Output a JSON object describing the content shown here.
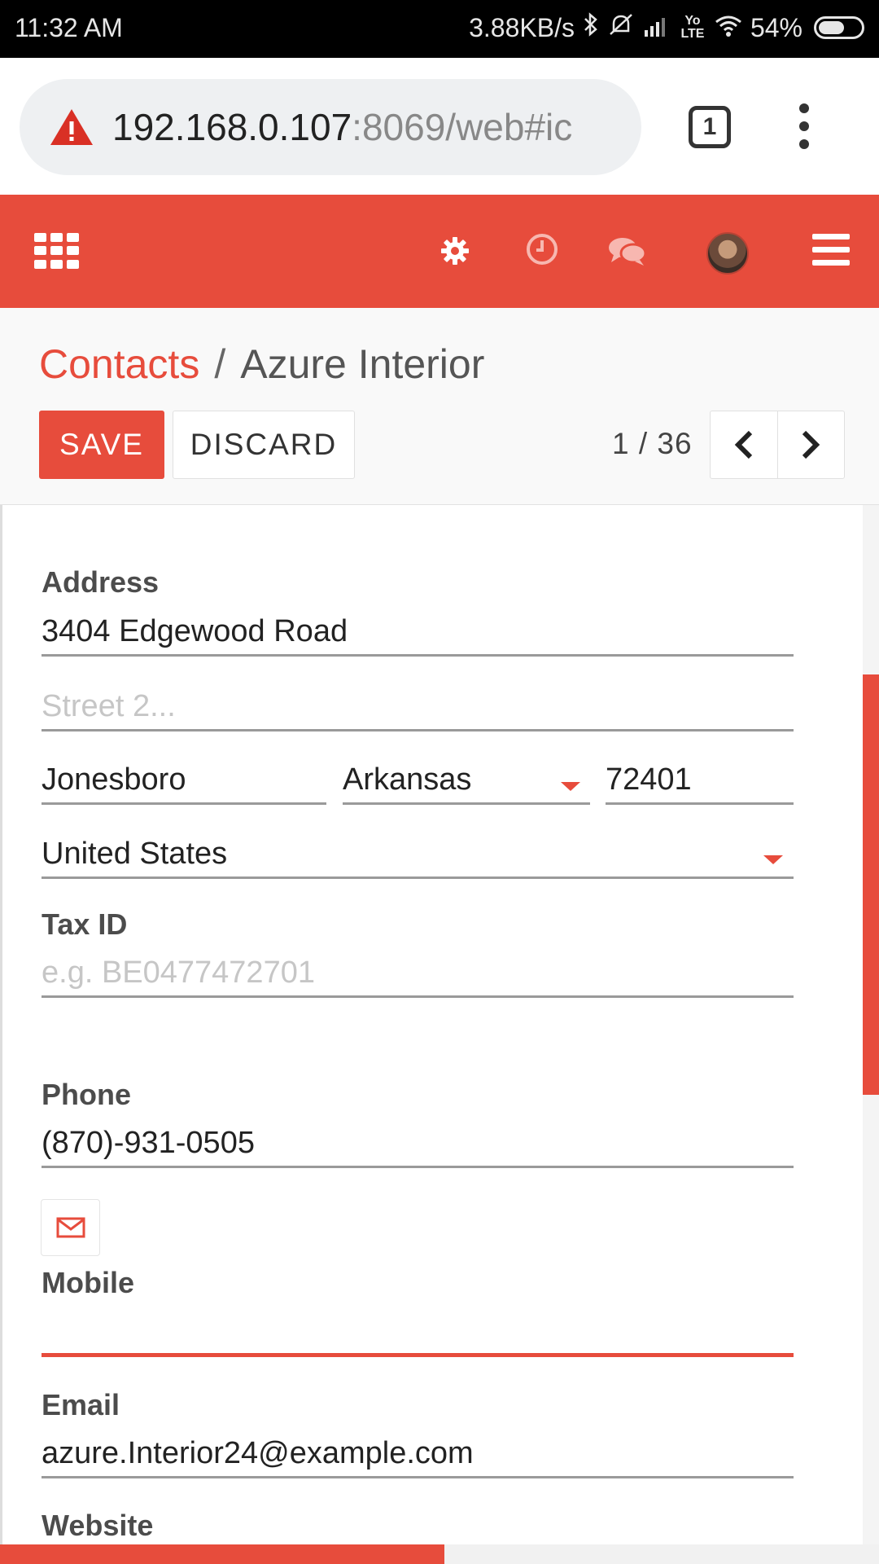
{
  "status_bar": {
    "time": "11:32 AM",
    "network_speed": "3.88KB/s",
    "battery": "54%",
    "lte_label": "Yo LTE"
  },
  "browser": {
    "url_host": "192.168.0.107",
    "url_rest": ":8069/web#ic",
    "tab_count": "1"
  },
  "app_nav": {
    "icons": [
      "apps-grid-icon",
      "settings-gear-icon",
      "activity-clock-icon",
      "discuss-chat-icon",
      "user-avatar",
      "hamburger-menu-icon"
    ]
  },
  "control_panel": {
    "breadcrumb_parent": "Contacts",
    "breadcrumb_separator": "/",
    "breadcrumb_current": "Azure Interior",
    "save_label": "SAVE",
    "discard_label": "DISCARD",
    "pager": "1 / 36"
  },
  "form": {
    "address_label": "Address",
    "street": "3404  Edgewood Road",
    "street2_placeholder": "Street 2...",
    "city": "Jonesboro",
    "state": "Arkansas",
    "zip": "72401",
    "country": "United States",
    "tax_id_label": "Tax ID",
    "tax_id_placeholder": "e.g. BE0477472701",
    "phone_label": "Phone",
    "phone": "(870)-931-0505",
    "mobile_label": "Mobile",
    "mobile": "",
    "email_label": "Email",
    "email": "azure.Interior24@example.com",
    "website_label": "Website"
  },
  "colors": {
    "brand": "#e74c3c",
    "text": "#222222",
    "label": "#4c4c4c"
  }
}
